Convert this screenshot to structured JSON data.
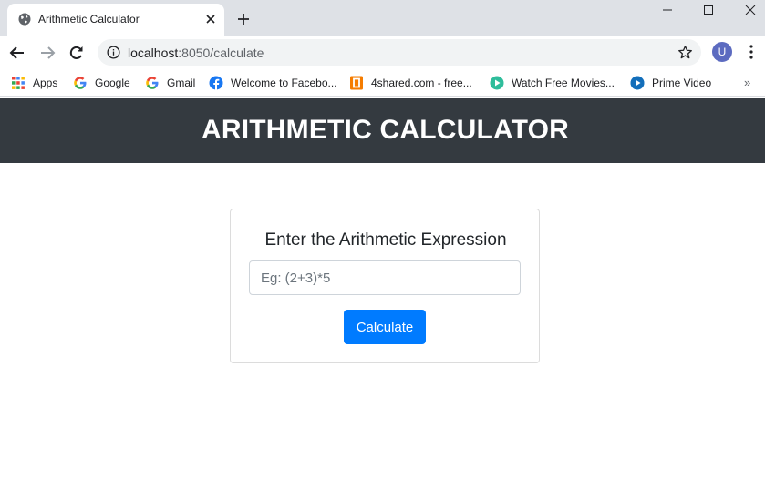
{
  "browser": {
    "tab": {
      "title": "Arithmetic Calculator",
      "icon": "globe-icon"
    },
    "address_bar": {
      "host": "localhost",
      "port_path": ":8050/calculate"
    },
    "profile_initial": "U",
    "bookmarks": [
      {
        "label": "Apps",
        "icon": "apps-grid-icon"
      },
      {
        "label": "Google",
        "icon": "google-icon"
      },
      {
        "label": "Gmail",
        "icon": "google-icon"
      },
      {
        "label": "Welcome to Facebo...",
        "icon": "facebook-icon"
      },
      {
        "label": "4shared.com - free...",
        "icon": "4shared-icon"
      },
      {
        "label": "Watch Free Movies...",
        "icon": "play-icon"
      },
      {
        "label": "Prime Video",
        "icon": "prime-video-icon"
      }
    ],
    "more_bookmarks": "»"
  },
  "header": {
    "title": "ARITHMETIC CALCULATOR"
  },
  "calculator": {
    "heading": "Enter the Arithmetic Expression",
    "input_placeholder": "Eg: (2+3)*5",
    "input_value": "",
    "button_label": "Calculate"
  },
  "colors": {
    "header_bg": "#343a40",
    "button_bg": "#007bff",
    "tabstrip_bg": "#dee1e6"
  }
}
